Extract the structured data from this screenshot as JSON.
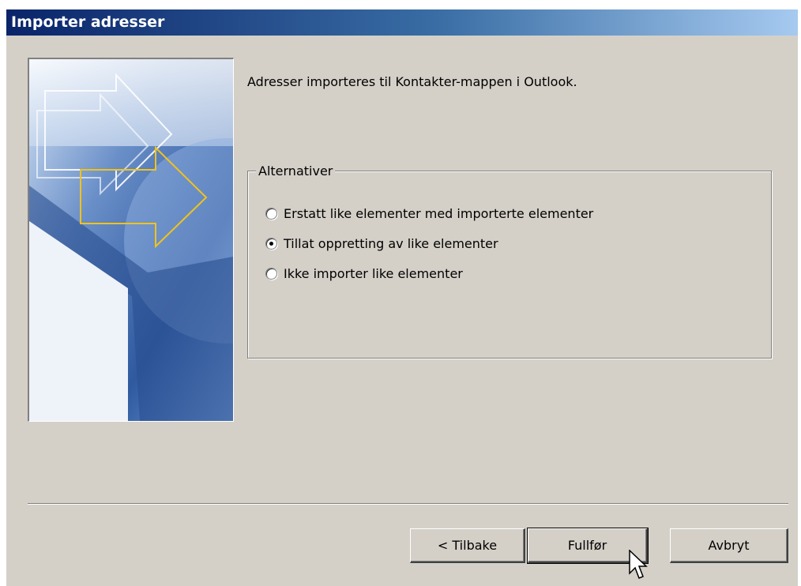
{
  "window": {
    "title": "Importer adresser"
  },
  "intro_text": "Adresser importeres til Kontakter-mappen i Outlook.",
  "options_group": {
    "legend": "Alternativer",
    "options": [
      {
        "label": "Erstatt like elementer med importerte elementer",
        "selected": false
      },
      {
        "label": "Tillat oppretting av like elementer",
        "selected": true
      },
      {
        "label": "Ikke importer like elementer",
        "selected": false
      }
    ]
  },
  "buttons": {
    "back": "< Tilbake",
    "finish": "Fullfør",
    "cancel": "Avbryt"
  },
  "colors": {
    "title_gradient_start": "#0a246a",
    "title_gradient_end": "#a6caf0",
    "dialog_bg": "#d4d0c8"
  }
}
